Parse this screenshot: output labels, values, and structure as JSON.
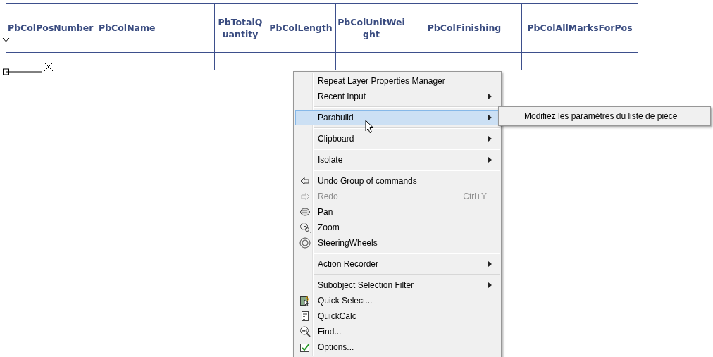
{
  "table": {
    "columns": [
      "PbColPosNumber",
      "PbColName",
      "PbTotalQuantity",
      "PbColLength",
      "PbColUnitWeight",
      "PbColFinishing",
      "PbColAllMarksForPos"
    ]
  },
  "context_menu": {
    "items": [
      {
        "kind": "command",
        "label": "Repeat Layer Properties Manager",
        "selected": false,
        "disabled": false
      },
      {
        "kind": "submenu",
        "label": "Recent Input",
        "selected": false,
        "disabled": false
      },
      {
        "kind": "separator"
      },
      {
        "kind": "submenu",
        "label": "Parabuild",
        "selected": true,
        "disabled": false
      },
      {
        "kind": "separator"
      },
      {
        "kind": "submenu",
        "label": "Clipboard",
        "selected": false,
        "disabled": false
      },
      {
        "kind": "separator"
      },
      {
        "kind": "submenu",
        "label": "Isolate",
        "selected": false,
        "disabled": false
      },
      {
        "kind": "separator"
      },
      {
        "kind": "command",
        "label": "Undo Group of commands",
        "selected": false,
        "disabled": false
      },
      {
        "kind": "command",
        "label": "Redo",
        "shortcut": "Ctrl+Y",
        "selected": false,
        "disabled": true
      },
      {
        "kind": "command",
        "label": "Pan",
        "selected": false,
        "disabled": false
      },
      {
        "kind": "command",
        "label": "Zoom",
        "selected": false,
        "disabled": false
      },
      {
        "kind": "command",
        "label": "SteeringWheels",
        "selected": false,
        "disabled": false
      },
      {
        "kind": "separator"
      },
      {
        "kind": "submenu",
        "label": "Action Recorder",
        "selected": false,
        "disabled": false
      },
      {
        "kind": "separator"
      },
      {
        "kind": "submenu",
        "label": "Subobject Selection Filter",
        "selected": false,
        "disabled": false
      },
      {
        "kind": "command",
        "label": "Quick Select...",
        "selected": false,
        "disabled": false
      },
      {
        "kind": "command",
        "label": "QuickCalc",
        "selected": false,
        "disabled": false
      },
      {
        "kind": "command",
        "label": "Find...",
        "selected": false,
        "disabled": false
      },
      {
        "kind": "command",
        "label": "Options...",
        "selected": false,
        "disabled": false
      }
    ]
  },
  "submenu": {
    "items": [
      {
        "label": "Modifiez les paramètres du liste de pièce",
        "selected": false
      }
    ]
  }
}
